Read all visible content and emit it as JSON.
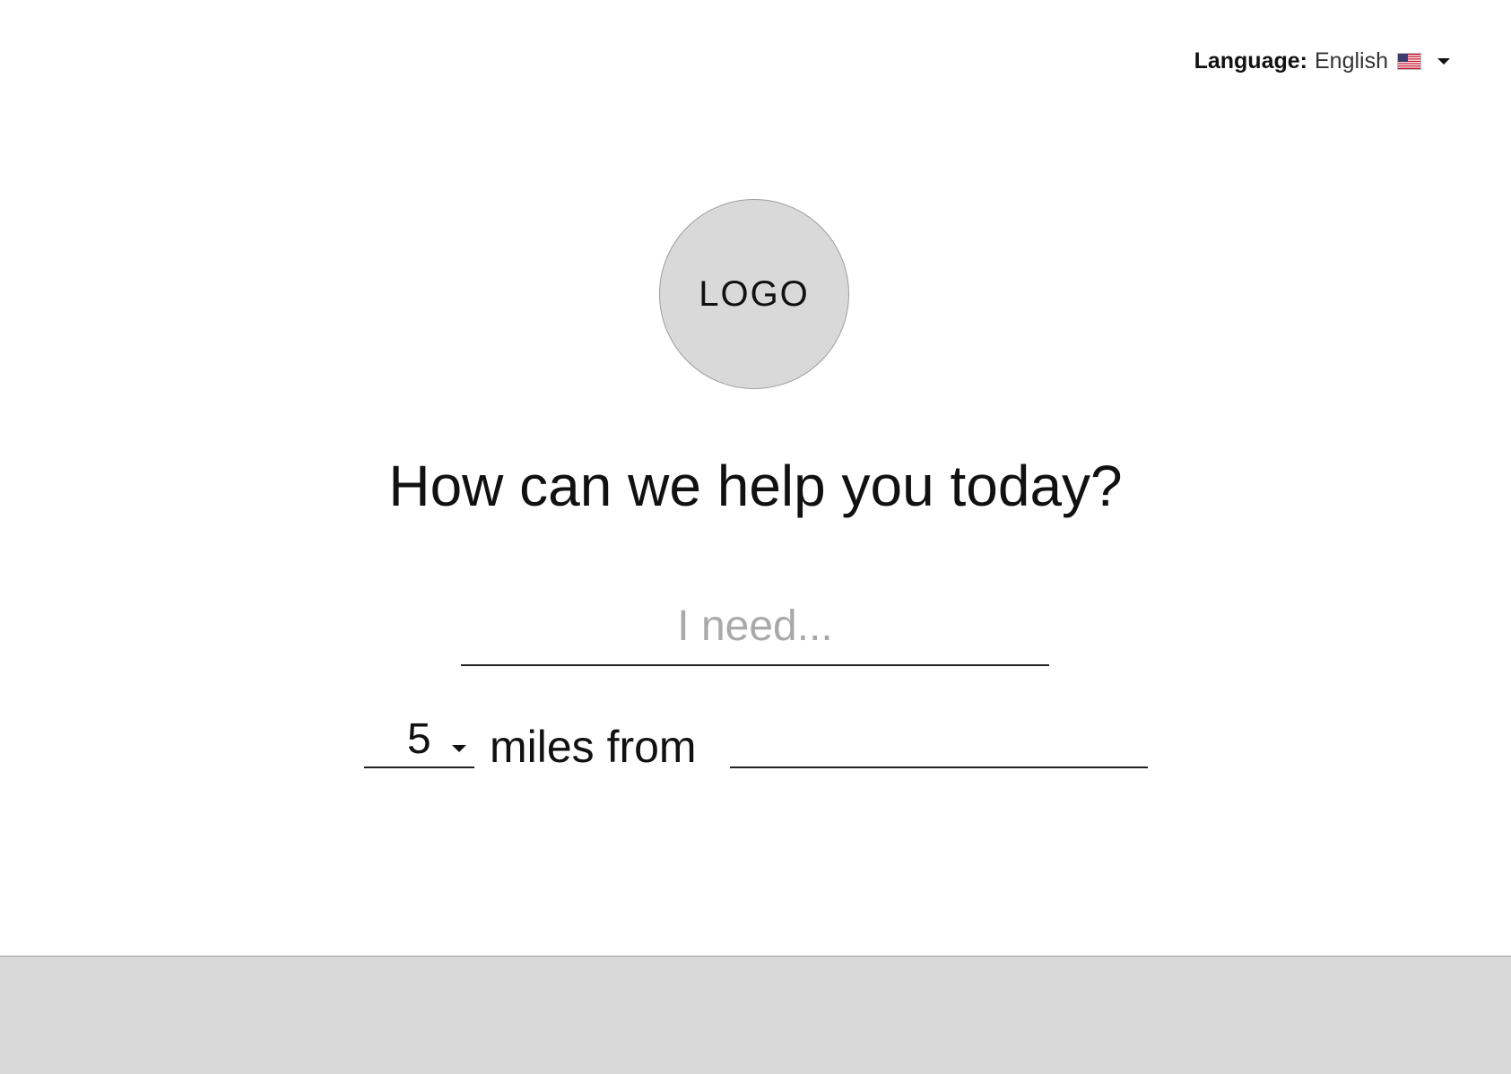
{
  "language": {
    "label": "Language:",
    "value": "English",
    "flag_icon": "us-flag-icon",
    "dropdown_icon": "chevron-down-icon"
  },
  "logo": {
    "text": "LOGO"
  },
  "hero": {
    "title": "How can we help you today?"
  },
  "search": {
    "need_placeholder": "I need...",
    "need_value": "",
    "distance_value": "5",
    "distance_suffix": "miles from",
    "location_value": "",
    "location_placeholder": ""
  },
  "colors": {
    "placeholder_gray": "#a9a9a9",
    "logo_fill": "#d9d9d9",
    "footer_fill": "#d9d9d9"
  }
}
